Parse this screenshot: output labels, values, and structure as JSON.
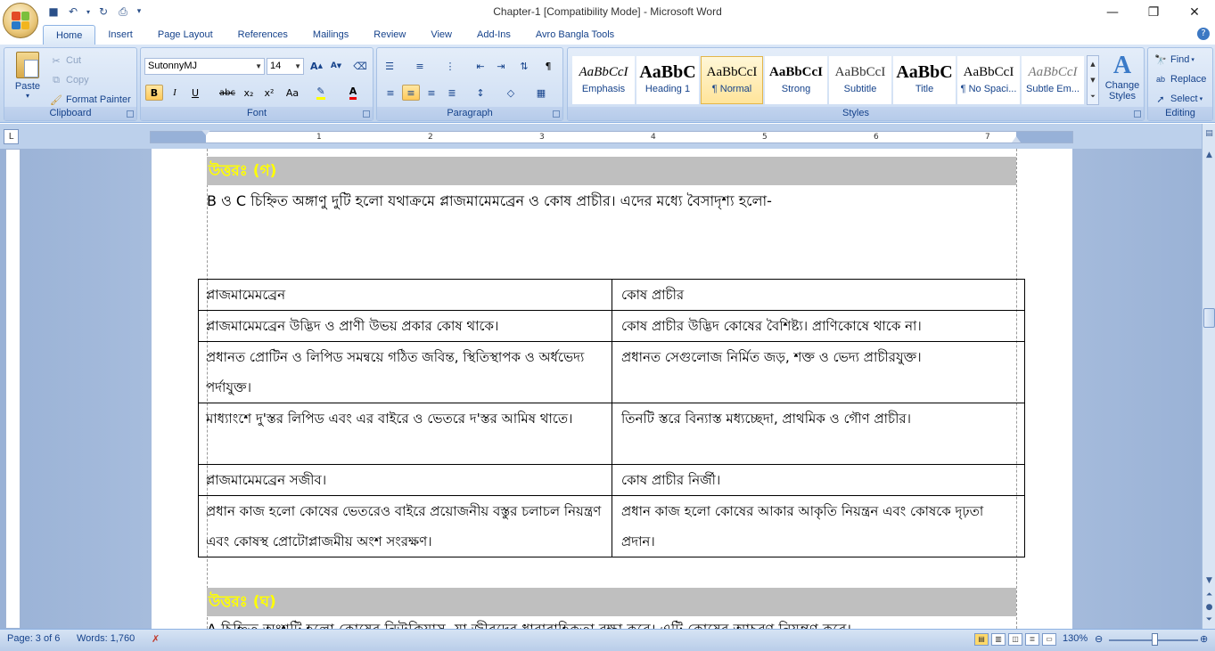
{
  "window": {
    "title": "Chapter-1 [Compatibility Mode] - Microsoft Word"
  },
  "quick_access": [
    {
      "name": "save-icon",
      "glyph": "💾"
    },
    {
      "name": "undo-icon",
      "glyph": "↶"
    },
    {
      "name": "redo-icon",
      "glyph": "↻"
    },
    {
      "name": "print-preview-icon",
      "glyph": "🔍"
    },
    {
      "name": "customize-icon",
      "glyph": "▾"
    }
  ],
  "tabs": [
    "Home",
    "Insert",
    "Page Layout",
    "References",
    "Mailings",
    "Review",
    "View",
    "Add-Ins",
    "Avro Bangla Tools"
  ],
  "active_tab": "Home",
  "clipboard": {
    "paste": "Paste",
    "cut": "Cut",
    "copy": "Copy",
    "format_painter": "Format Painter",
    "label": "Clipboard"
  },
  "font": {
    "family": "SutonnyMJ",
    "size": "14",
    "label": "Font",
    "bold": "B",
    "italic": "I",
    "underline": "U",
    "strike": "abc",
    "subscript": "x₂",
    "superscript": "x²",
    "case": "Aa",
    "grow": "A",
    "shrink": "A"
  },
  "paragraph": {
    "label": "Paragraph"
  },
  "styles": {
    "label": "Styles",
    "items": [
      {
        "preview": "AaBbCcI",
        "name": "Emphasis"
      },
      {
        "preview": "AaBbC",
        "name": "Heading 1"
      },
      {
        "preview": "AaBbCcI",
        "name": "¶ Normal"
      },
      {
        "preview": "AaBbCcI",
        "name": "Strong"
      },
      {
        "preview": "AaBbCcI",
        "name": "Subtitle"
      },
      {
        "preview": "AaBbC",
        "name": "Title"
      },
      {
        "preview": "AaBbCcI",
        "name": "¶ No Spaci..."
      },
      {
        "preview": "AaBbCcI",
        "name": "Subtle Em..."
      }
    ],
    "selected_index": 2,
    "change_styles": "Change Styles"
  },
  "editing": {
    "find": "Find",
    "replace": "Replace",
    "select": "Select",
    "label": "Editing"
  },
  "ruler": {
    "ticks": [
      "1",
      "2",
      "3",
      "4",
      "5",
      "6",
      "7"
    ]
  },
  "document": {
    "answer_c": "উত্তরঃ (গ)",
    "intro": "B ও C চিহ্নিত অঙ্গাণু দুটি হলো যথাক্রমে প্লাজমামেমব্রেন ও কোষ প্রাচীর। এদের মধ্যে বৈসাদৃশ্য হলো-",
    "table": [
      [
        "প্লাজমামেমব্রেন",
        " কোষ প্রাচীর"
      ],
      [
        "প্লাজমামেমব্রেন উদ্ভিদ ও প্রাণী উভয় প্রকার কোষ থাকে।",
        "কোষ প্রাচীর উদ্ভিদ কোষের বৈশিষ্ট্য। প্রাণিকোষে থাকে না।"
      ],
      [
        "প্রধানত প্রোটিন ও লিপিড সমন্বয়ে গঠিত জবিন্ত, স্থিতিস্থাপক ও অর্ধভেদ্য পর্দাযুক্ত।",
        "প্রধানত সেগুলোজ নির্মিত জড়, শক্ত ও ভেদ্য প্রাচীরযুক্ত।"
      ],
      [
        "মাধ্যাংশে দু'স্তর লিপিড এবং এর বাইরে ও ভেতরে দ'স্তর আমিষ থাতে।",
        "তিনটি স্তরে বিন্যাস্ত মধ্যচ্ছেদা, প্রাথমিক ও গৌণ প্রাচীর।"
      ],
      [
        "প্লাজমামেমব্রেন সজীব।",
        " কোষ প্রাচীর নির্জী।"
      ],
      [
        "প্রধান কাজ হলো কোষের ভেতরেও বাইরে প্রয়োজনীয় বস্তুর চলাচল নিয়ন্ত্রণ এবং কোষস্থ প্রোটোপ্লাজমীয় অংশ সংরক্ষণ।",
        "প্রধান কাজ হলো কোষের আকার আকৃতি নিয়ন্ত্রন এবং কোষকে দৃঢ়তা প্রদান।"
      ]
    ],
    "answer_d": "উত্তরঃ (ঘ)",
    "next_para": "A চিহ্নিত অংশটি হলো কোষের নিউক্লিয়াস, যা জীবদের ধারাবাহিকতা রক্ষা করে। এটি কোষের আচরণ নিয়ন্ত্রণ করে।"
  },
  "status": {
    "page": "Page: 3 of 6",
    "words": "Words: 1,760",
    "zoom": "130%",
    "zoom_value": 130
  },
  "colors": {
    "accent": "#15428b",
    "ribbon": "#dbe7f7",
    "answer_bg": "#bfbfbf",
    "answer_text": "#ffff00"
  }
}
